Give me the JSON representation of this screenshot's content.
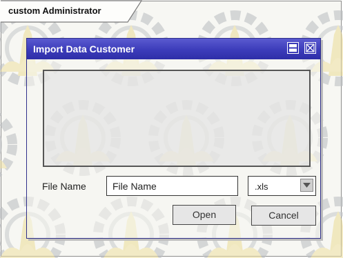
{
  "panel": {
    "tab_label": "custom Administrator"
  },
  "dialog": {
    "title": "Import Data Customer",
    "controls": [
      "maximize-icon",
      "close-icon"
    ],
    "file_name_label": "File Name",
    "file_name_value": "File Name",
    "file_type_value": ".xls",
    "open_label": "Open",
    "cancel_label": "Cancel"
  },
  "colors": {
    "titlebar": "#3c3cba",
    "frame_border": "#8c8c8c",
    "watermark_gold": "#e8d58a",
    "watermark_gray": "#b9bcc0"
  }
}
